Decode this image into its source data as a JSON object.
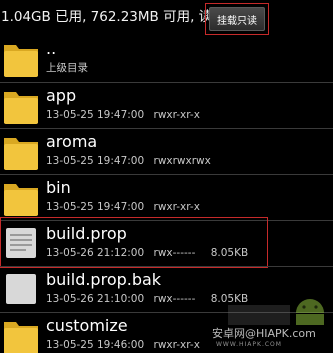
{
  "header": {
    "storage_info": "1.04GB 已用, 762.23MB 可用, 读写",
    "mount_label": "挂载只读"
  },
  "files": [
    {
      "name": "..",
      "meta": "上级目录",
      "type": "folder"
    },
    {
      "name": "app",
      "date": "13-05-25 19:47:00",
      "perms": "rwxr-xr-x",
      "size": "",
      "type": "folder"
    },
    {
      "name": "aroma",
      "date": "13-05-25 19:47:00",
      "perms": "rwxrwxrwx",
      "size": "",
      "type": "folder"
    },
    {
      "name": "bin",
      "date": "13-05-25 19:47:00",
      "perms": "rwxr-xr-x",
      "size": "",
      "type": "folder"
    },
    {
      "name": "build.prop",
      "date": "13-05-26 21:12:00",
      "perms": "rwx------",
      "size": "8.05KB",
      "type": "file"
    },
    {
      "name": "build.prop.bak",
      "date": "13-05-26 21:10:00",
      "perms": "rwx------",
      "size": "8.05KB",
      "type": "file"
    },
    {
      "name": "customize",
      "date": "13-05-25 19:46:00",
      "perms": "rwxr-xr-x",
      "size": "",
      "type": "folder"
    }
  ],
  "watermark": {
    "text": "安卓网@HIAPK.com",
    "sub": "WWW.HIAPK.COM"
  },
  "colors": {
    "highlight_border": "#c62a2a",
    "folder": "#f2c53d"
  }
}
